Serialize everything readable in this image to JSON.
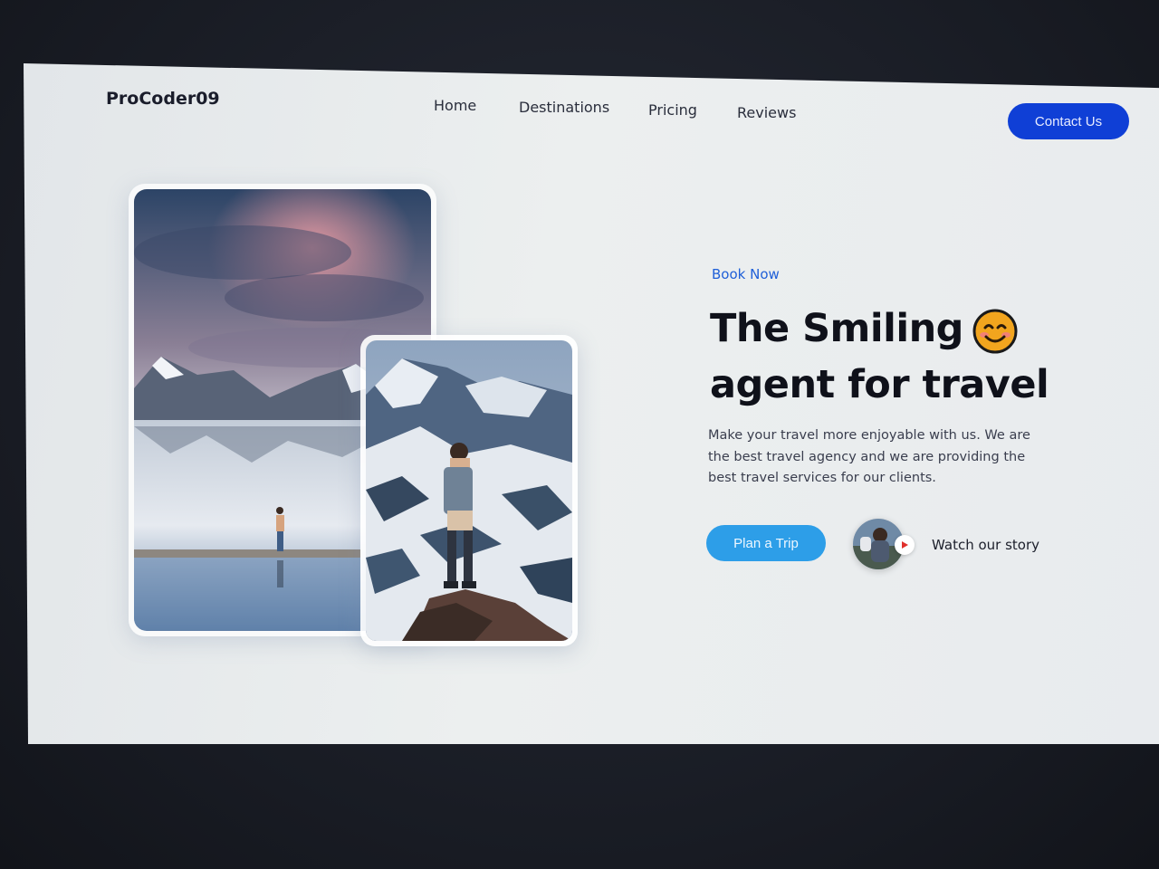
{
  "header": {
    "logo": "ProCoder09",
    "nav": [
      "Home",
      "Destinations",
      "Pricing",
      "Reviews"
    ],
    "contact_label": "Contact Us"
  },
  "hero": {
    "kicker": "Book Now",
    "title_line1": "The Smiling",
    "title_line2": "agent for travel",
    "description": "Make your travel more enjoyable with us. We are the best travel agency and we are providing the best travel services for our clients.",
    "plan_label": "Plan a Trip",
    "watch_label": "Watch our story"
  },
  "icons": {
    "emoji": "smiling-face-icon",
    "play": "play-icon"
  },
  "colors": {
    "primary_blue": "#0f3fd6",
    "plan_blue": "#2d9ee8",
    "kicker_blue": "#1f5fd8",
    "text_dark": "#0f111a"
  }
}
